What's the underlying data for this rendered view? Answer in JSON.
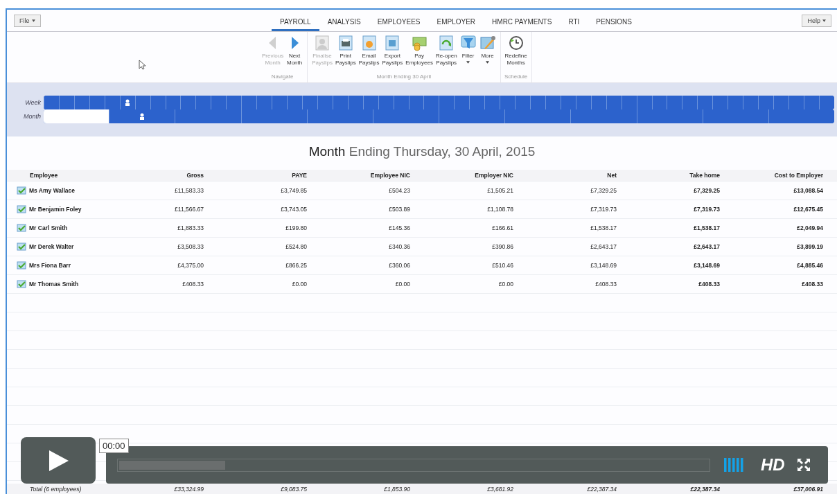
{
  "file_menu": {
    "label": "File"
  },
  "tabs": [
    {
      "label": "PAYROLL",
      "selected": true
    },
    {
      "label": "ANALYSIS",
      "selected": false
    },
    {
      "label": "EMPLOYEES",
      "selected": false
    },
    {
      "label": "EMPLOYER",
      "selected": false
    },
    {
      "label": "HMRC PAYMENTS",
      "selected": false
    },
    {
      "label": "RTI",
      "selected": false
    },
    {
      "label": "PENSIONS",
      "selected": false
    }
  ],
  "help_menu": {
    "label": "Help"
  },
  "ribbon_groups": [
    {
      "label": "Navigate",
      "buttons": [
        {
          "label": "Previous\nMonth",
          "kind": "back",
          "disabled": true,
          "dropdown": false
        },
        {
          "label": "Next\nMonth",
          "kind": "forward",
          "disabled": false,
          "dropdown": false
        }
      ]
    },
    {
      "label": "Month Ending 30 April",
      "buttons": [
        {
          "label": "Finalise\nPayslips",
          "kind": "finalise",
          "disabled": true,
          "dropdown": false
        },
        {
          "label": "Print\nPayslips",
          "kind": "print",
          "disabled": false,
          "dropdown": false
        },
        {
          "label": "Email\nPayslips",
          "kind": "email",
          "disabled": false,
          "dropdown": false
        },
        {
          "label": "Export\nPayslips",
          "kind": "export",
          "disabled": false,
          "dropdown": false
        },
        {
          "label": "Pay\nEmployees",
          "kind": "pay",
          "disabled": false,
          "dropdown": false
        },
        {
          "label": "Re-open\nPayslips",
          "kind": "reopen",
          "disabled": false,
          "dropdown": false
        },
        {
          "label": "Filter",
          "kind": "filter",
          "disabled": false,
          "dropdown": true
        },
        {
          "label": "More",
          "kind": "more",
          "disabled": false,
          "dropdown": true
        }
      ]
    },
    {
      "label": "Schedule",
      "buttons": [
        {
          "label": "Redefine\nMonths",
          "kind": "clock",
          "disabled": false,
          "dropdown": false
        }
      ]
    }
  ],
  "week_timeline": {
    "label": "Week",
    "cells": [
      {
        "current": false
      },
      {
        "current": false
      },
      {
        "current": false
      },
      {
        "current": false
      },
      {
        "current": false
      },
      {
        "current": true
      },
      {
        "current": false
      },
      {
        "current": false
      },
      {
        "current": false
      },
      {
        "current": false
      },
      {
        "current": false
      },
      {
        "current": false
      },
      {
        "current": false
      },
      {
        "current": false
      },
      {
        "current": false
      },
      {
        "current": false
      },
      {
        "current": false
      },
      {
        "current": false
      },
      {
        "current": false
      },
      {
        "current": false
      },
      {
        "current": false
      },
      {
        "current": false
      },
      {
        "current": false
      },
      {
        "current": false
      },
      {
        "current": false
      },
      {
        "current": false
      },
      {
        "current": false
      },
      {
        "current": false
      },
      {
        "current": false
      },
      {
        "current": false
      },
      {
        "current": false
      },
      {
        "current": false
      },
      {
        "current": false
      },
      {
        "current": false
      },
      {
        "current": false
      },
      {
        "current": false
      },
      {
        "current": false
      },
      {
        "current": false
      },
      {
        "current": false
      },
      {
        "current": false
      },
      {
        "current": false
      },
      {
        "current": false
      },
      {
        "current": false
      },
      {
        "current": false
      },
      {
        "current": false
      },
      {
        "current": false
      },
      {
        "current": false
      },
      {
        "current": false
      },
      {
        "current": false
      },
      {
        "current": false
      },
      {
        "current": false
      },
      {
        "current": false
      }
    ]
  },
  "month_timeline": {
    "label": "Month",
    "cells": [
      {
        "current": false,
        "disabled": true
      },
      {
        "current": true,
        "disabled": false
      },
      {
        "current": false,
        "disabled": false
      },
      {
        "current": false,
        "disabled": false
      },
      {
        "current": false,
        "disabled": false
      },
      {
        "current": false,
        "disabled": false
      },
      {
        "current": false,
        "disabled": false
      },
      {
        "current": false,
        "disabled": false
      },
      {
        "current": false,
        "disabled": false
      },
      {
        "current": false,
        "disabled": false
      },
      {
        "current": false,
        "disabled": false
      },
      {
        "current": false,
        "disabled": false
      }
    ]
  },
  "period_title": {
    "lead": "Month",
    "rest": "Ending Thursday, 30 April, 2015"
  },
  "table": {
    "columns": [
      {
        "label": "Employee"
      },
      {
        "label": "Gross",
        "emphasis": false
      },
      {
        "label": "PAYE",
        "emphasis": false
      },
      {
        "label": "Employee NIC",
        "emphasis": false
      },
      {
        "label": "Employer NIC",
        "emphasis": false
      },
      {
        "label": "Net",
        "emphasis": false
      },
      {
        "label": "Take home",
        "emphasis": true
      },
      {
        "label": "Cost to Employer",
        "emphasis": true
      }
    ],
    "rows": [
      {
        "name": "Ms Amy Wallace",
        "values": [
          "£11,583.33",
          "£3,749.85",
          "£504.23",
          "£1,505.21",
          "£7,329.25",
          "£7,329.25",
          "£13,088.54"
        ]
      },
      {
        "name": "Mr Benjamin Foley",
        "values": [
          "£11,566.67",
          "£3,743.05",
          "£503.89",
          "£1,108.78",
          "£7,319.73",
          "£7,319.73",
          "£12,675.45"
        ]
      },
      {
        "name": "Mr Carl Smith",
        "values": [
          "£1,883.33",
          "£199.80",
          "£145.36",
          "£166.61",
          "£1,538.17",
          "£1,538.17",
          "£2,049.94"
        ]
      },
      {
        "name": "Mr Derek Walter",
        "values": [
          "£3,508.33",
          "£524.80",
          "£340.36",
          "£390.86",
          "£2,643.17",
          "£2,643.17",
          "£3,899.19"
        ]
      },
      {
        "name": "Mrs Fiona Barr",
        "values": [
          "£4,375.00",
          "£866.25",
          "£360.06",
          "£510.46",
          "£3,148.69",
          "£3,148.69",
          "£4,885.46"
        ]
      },
      {
        "name": "Mr Thomas Smith",
        "values": [
          "£408.33",
          "£0.00",
          "£0.00",
          "£0.00",
          "£408.33",
          "£408.33",
          "£408.33"
        ]
      }
    ],
    "total": {
      "label": "Total (6 employees)",
      "values": [
        "£33,324.99",
        "£9,083.75",
        "£1,853.90",
        "£3,681.92",
        "£22,387.34",
        "£22,387.34",
        "£37,006.91"
      ]
    }
  },
  "video_player": {
    "playing": false,
    "time": "00:00",
    "buffered": {
      "level": 0.18
    },
    "quality": "HD"
  }
}
